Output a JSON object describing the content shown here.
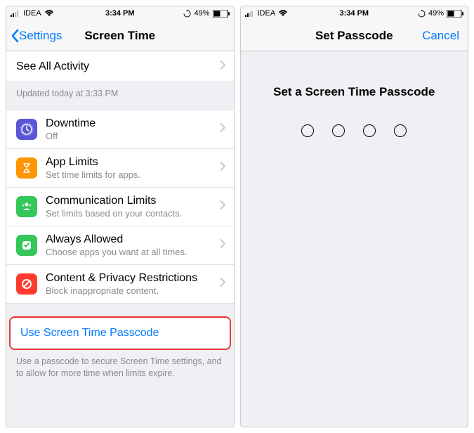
{
  "status": {
    "carrier": "IDEA",
    "time": "3:34 PM",
    "battery": "49%"
  },
  "left": {
    "back": "Settings",
    "title": "Screen Time",
    "see_all": "See All Activity",
    "updated": "Updated today at 3:33 PM",
    "items": [
      {
        "title": "Downtime",
        "sub": "Off",
        "color": "#5856d6"
      },
      {
        "title": "App Limits",
        "sub": "Set time limits for apps.",
        "color": "#ff9500"
      },
      {
        "title": "Communication Limits",
        "sub": "Set limits based on your contacts.",
        "color": "#34c759"
      },
      {
        "title": "Always Allowed",
        "sub": "Choose apps you want at all times.",
        "color": "#34c759"
      },
      {
        "title": "Content & Privacy Restrictions",
        "sub": "Block inappropriate content.",
        "color": "#ff3b30"
      }
    ],
    "use_passcode": "Use Screen Time Passcode",
    "footer": "Use a passcode to secure Screen Time settings, and to allow for more time when limits expire."
  },
  "right": {
    "title": "Set Passcode",
    "cancel": "Cancel",
    "prompt": "Set a Screen Time Passcode"
  }
}
